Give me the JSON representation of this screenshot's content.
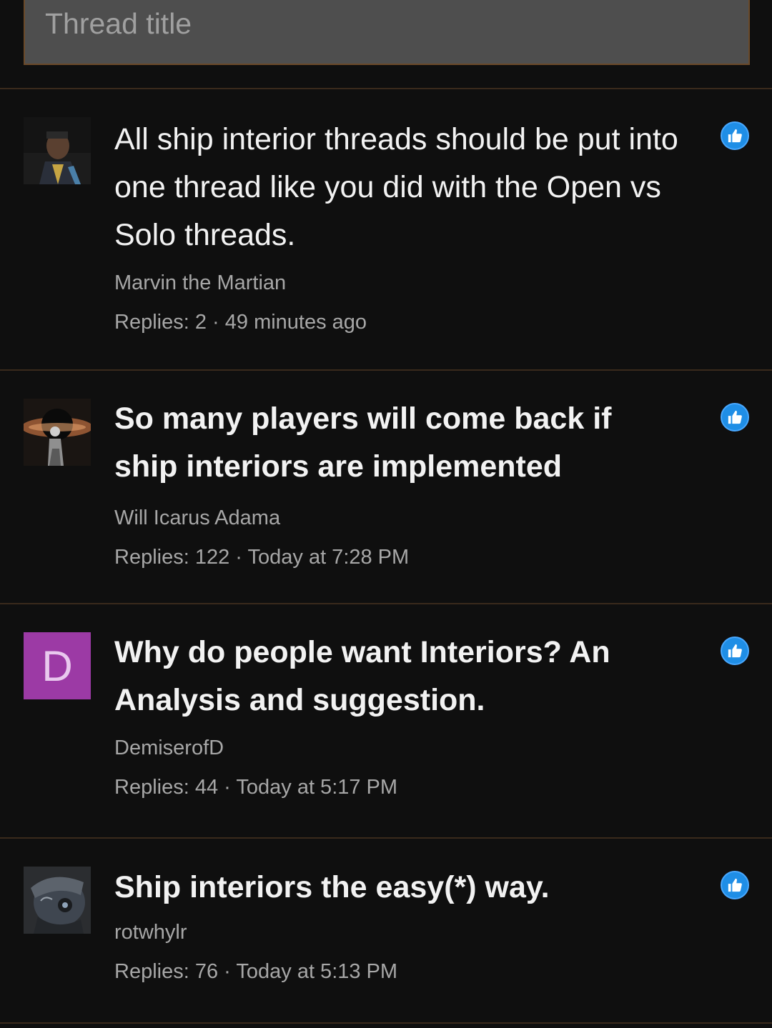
{
  "search": {
    "placeholder": "Thread title"
  },
  "threads": [
    {
      "title": "All ship interior threads should be put into one thread like you did with the Open vs Solo threads.",
      "author": "Marvin the Martian",
      "replies_label": "Replies: 2",
      "separator": "·",
      "time": "49 minutes ago",
      "unread": false
    },
    {
      "title": "So many players will come back if ship interiors are implemented",
      "author": "Will Icarus Adama",
      "replies_label": "Replies: 122",
      "separator": "·",
      "time": "Today at 7:28 PM",
      "unread": true
    },
    {
      "title": "Why do people want Interiors? An Analysis and suggestion.",
      "author": "DemiserofD",
      "avatar_letter": "D",
      "replies_label": "Replies: 44",
      "separator": "·",
      "time": "Today at 5:17 PM",
      "unread": true
    },
    {
      "title": "Ship interiors the easy(*) way.",
      "author": "rotwhylr",
      "replies_label": "Replies: 76",
      "separator": "·",
      "time": "Today at 5:13 PM",
      "unread": true
    }
  ],
  "icons": {
    "like": "thumbs-up-icon"
  },
  "colors": {
    "background": "#0f0f0f",
    "divider": "#3a2a1c",
    "like_badge": "#1f8ee6",
    "letter_avatar": "#9c3aa5"
  }
}
